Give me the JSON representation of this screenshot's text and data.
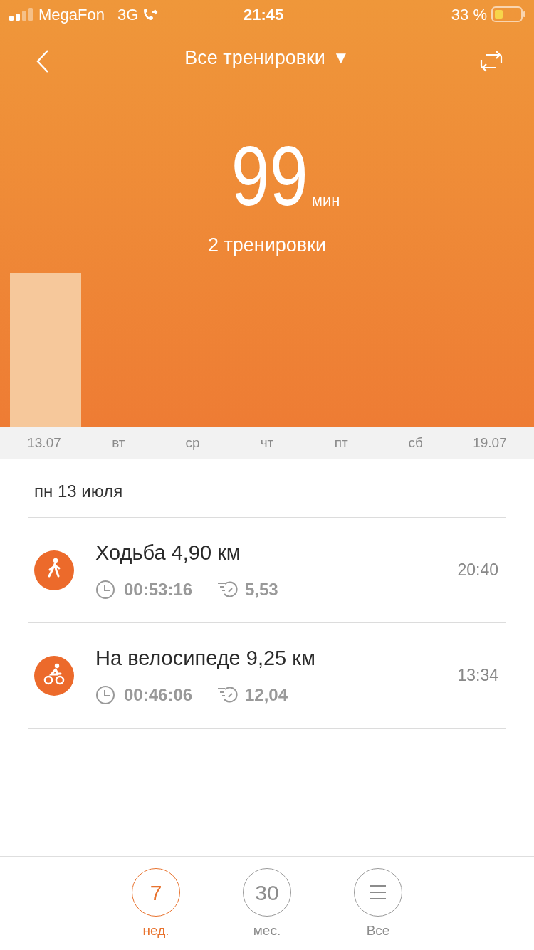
{
  "status_bar": {
    "carrier": "MegaFon",
    "network": "3G",
    "time": "21:45",
    "battery": "33 %"
  },
  "nav": {
    "title": "Все тренировки",
    "dropdown": "▼"
  },
  "summary": {
    "value": "99",
    "unit": "мин",
    "count": "2 тренировки"
  },
  "axis": [
    "13.07",
    "вт",
    "ср",
    "чт",
    "пт",
    "сб",
    "19.07"
  ],
  "day": {
    "title": "пн 13 июля"
  },
  "workouts": [
    {
      "kind": "walk",
      "title": "Ходьба 4,90 км",
      "duration": "00:53:16",
      "pace": "5,53",
      "time": "20:40"
    },
    {
      "kind": "bike",
      "title": "На велосипеде 9,25 км",
      "duration": "00:46:06",
      "pace": "12,04",
      "time": "13:34"
    }
  ],
  "tabs": [
    {
      "kind": "number",
      "value": "7",
      "label": "нед.",
      "selected": true
    },
    {
      "kind": "number",
      "value": "30",
      "label": "мес.",
      "selected": false
    },
    {
      "kind": "list",
      "label": "Все",
      "selected": false
    }
  ]
}
